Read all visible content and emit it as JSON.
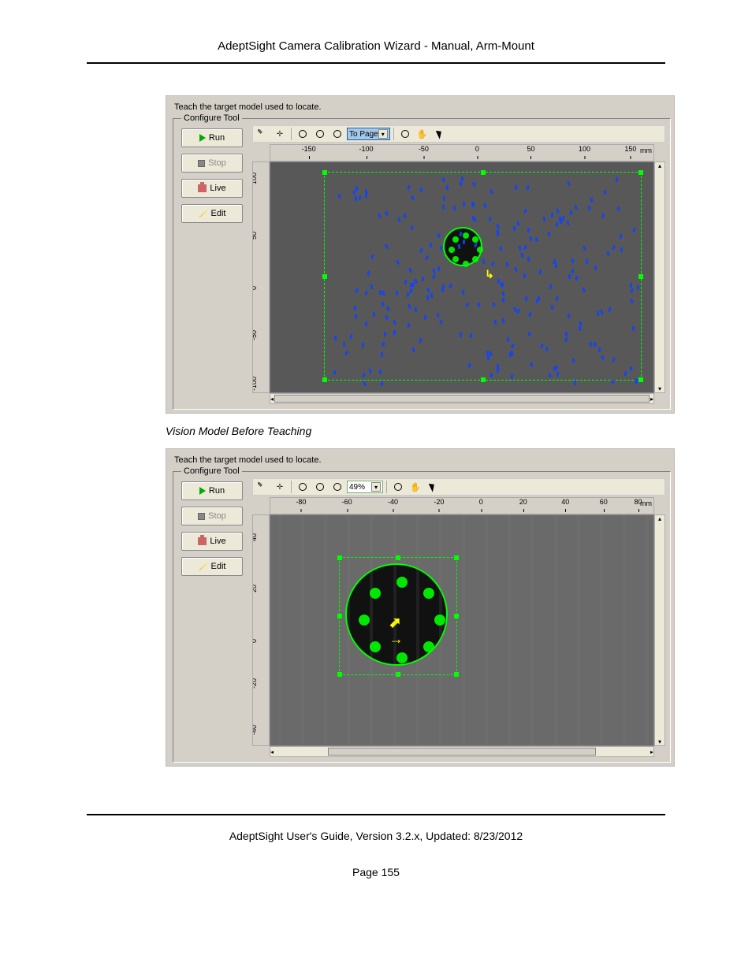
{
  "header": {
    "title": "AdeptSight Camera Calibration Wizard - Manual, Arm-Mount"
  },
  "caption1": "Vision Model Before Teaching",
  "footer": {
    "guide": "AdeptSight User's Guide,  Version 3.2.x, Updated: 8/23/2012",
    "page": "Page 155"
  },
  "panel_common": {
    "instruction": "Teach the target model used to locate.",
    "fieldset_label": "Configure Tool",
    "buttons": {
      "run": "Run",
      "stop": "Stop",
      "live": "Live",
      "edit": "Edit"
    },
    "ruler_unit": "mm"
  },
  "panel1": {
    "zoom_label": "To Page",
    "ruler_h": [
      {
        "v": "-150",
        "pct": 10
      },
      {
        "v": "-100",
        "pct": 25
      },
      {
        "v": "-50",
        "pct": 40
      },
      {
        "v": "0",
        "pct": 54
      },
      {
        "v": "50",
        "pct": 68
      },
      {
        "v": "100",
        "pct": 82
      },
      {
        "v": "150",
        "pct": 94
      }
    ],
    "ruler_v": [
      {
        "v": "100",
        "pct": 6
      },
      {
        "v": "50",
        "pct": 30
      },
      {
        "v": "0",
        "pct": 52
      },
      {
        "v": "-50",
        "pct": 74
      },
      {
        "v": "-100",
        "pct": 96
      }
    ]
  },
  "panel2": {
    "zoom_label": "49%",
    "ruler_h": [
      {
        "v": "-80",
        "pct": 8
      },
      {
        "v": "-60",
        "pct": 20
      },
      {
        "v": "-40",
        "pct": 32
      },
      {
        "v": "-20",
        "pct": 44
      },
      {
        "v": "0",
        "pct": 55
      },
      {
        "v": "20",
        "pct": 66
      },
      {
        "v": "40",
        "pct": 77
      },
      {
        "v": "60",
        "pct": 87
      },
      {
        "v": "80",
        "pct": 96
      }
    ],
    "ruler_v": [
      {
        "v": "40",
        "pct": 8
      },
      {
        "v": "20",
        "pct": 30
      },
      {
        "v": "0",
        "pct": 52
      },
      {
        "v": "-20",
        "pct": 72
      },
      {
        "v": "-40",
        "pct": 92
      }
    ]
  }
}
